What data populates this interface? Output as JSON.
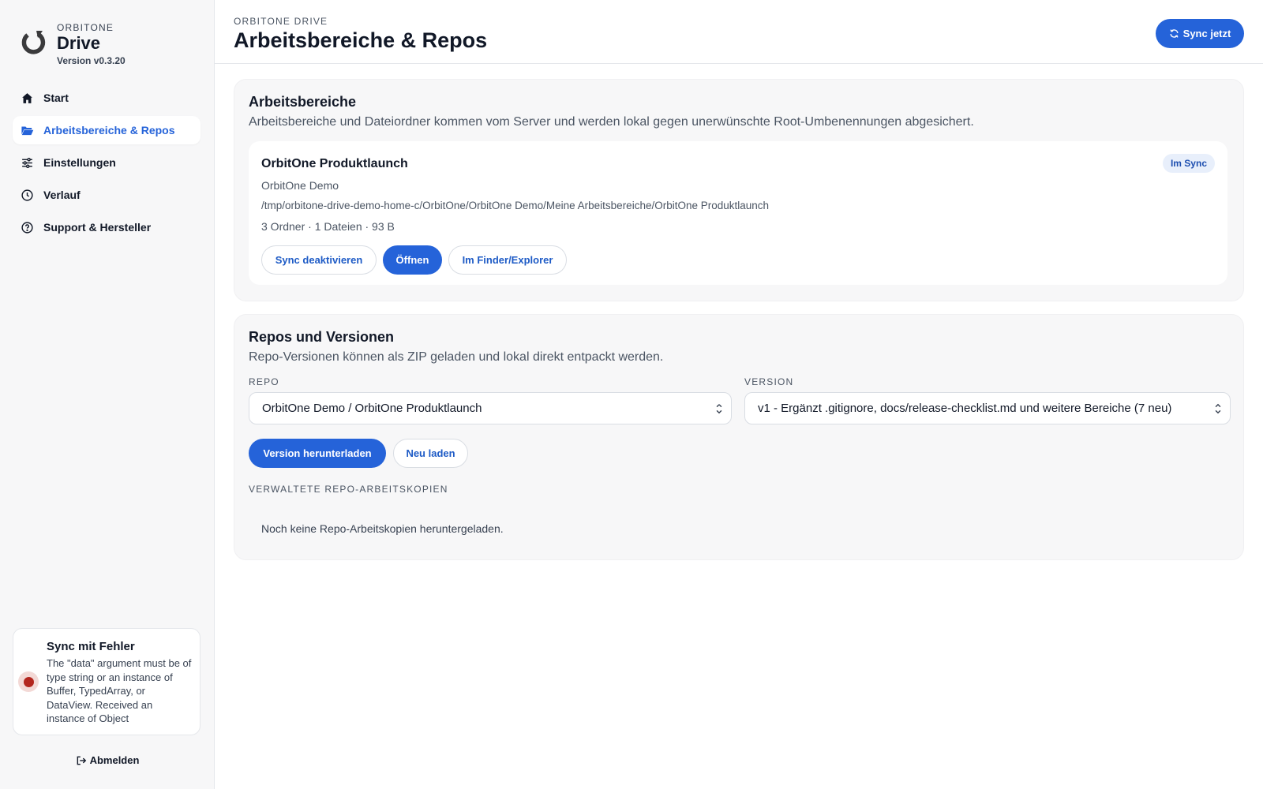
{
  "brand": {
    "kicker": "ORBITONE",
    "name": "Drive",
    "version": "Version v0.3.20"
  },
  "nav": {
    "items": [
      {
        "label": "Start",
        "icon": "home-icon",
        "active": false
      },
      {
        "label": "Arbeitsbereiche & Repos",
        "icon": "folder-open-icon",
        "active": true
      },
      {
        "label": "Einstellungen",
        "icon": "sliders-icon",
        "active": false
      },
      {
        "label": "Verlauf",
        "icon": "clock-icon",
        "active": false
      },
      {
        "label": "Support & Hersteller",
        "icon": "help-circle-icon",
        "active": false
      }
    ]
  },
  "status": {
    "title": "Sync mit Fehler",
    "message": "The \"data\" argument must be of type string or an instance of Buffer, TypedArray, or DataView. Received an instance of Object",
    "color": "#b3261e"
  },
  "logout": {
    "label": "Abmelden",
    "icon": "logout-icon"
  },
  "header": {
    "kicker": "ORBITONE DRIVE",
    "title": "Arbeitsbereiche & Repos",
    "sync_button": "Sync jetzt",
    "sync_icon": "refresh-icon"
  },
  "workspaces": {
    "title": "Arbeitsbereiche",
    "subtitle": "Arbeitsbereiche und Dateiordner kommen vom Server und werden lokal gegen unerwünschte Root-Umbenennungen abgesichert.",
    "card": {
      "name": "OrbitOne Produktlaunch",
      "badge": "Im Sync",
      "organization": "OrbitOne Demo",
      "path": "/tmp/orbitone-drive-demo-home-c/OrbitOne/OrbitOne Demo/Meine Arbeitsbereiche/OrbitOne Produktlaunch",
      "stats": "3 Ordner · 1 Dateien · 93 B",
      "buttons": {
        "disable_sync": "Sync deaktivieren",
        "open": "Öffnen",
        "finder": "Im Finder/Explorer"
      }
    }
  },
  "repos": {
    "title": "Repos und Versionen",
    "subtitle": "Repo-Versionen können als ZIP geladen und lokal direkt entpackt werden.",
    "repo_label": "REPO",
    "repo_value": "OrbitOne Demo / OrbitOne Produktlaunch",
    "version_label": "VERSION",
    "version_value": "v1 - Ergänzt .gitignore, docs/release-checklist.md und weitere Bereiche (7 neu)",
    "download_button": "Version herunterladen",
    "reload_button": "Neu laden",
    "managed_label": "VERWALTETE REPO-ARBEITSKOPIEN",
    "empty_text": "Noch keine Repo-Arbeitskopien heruntergeladen."
  },
  "colors": {
    "accent": "#2563d9",
    "error": "#b3261e",
    "badge_bg": "#e8effb"
  }
}
